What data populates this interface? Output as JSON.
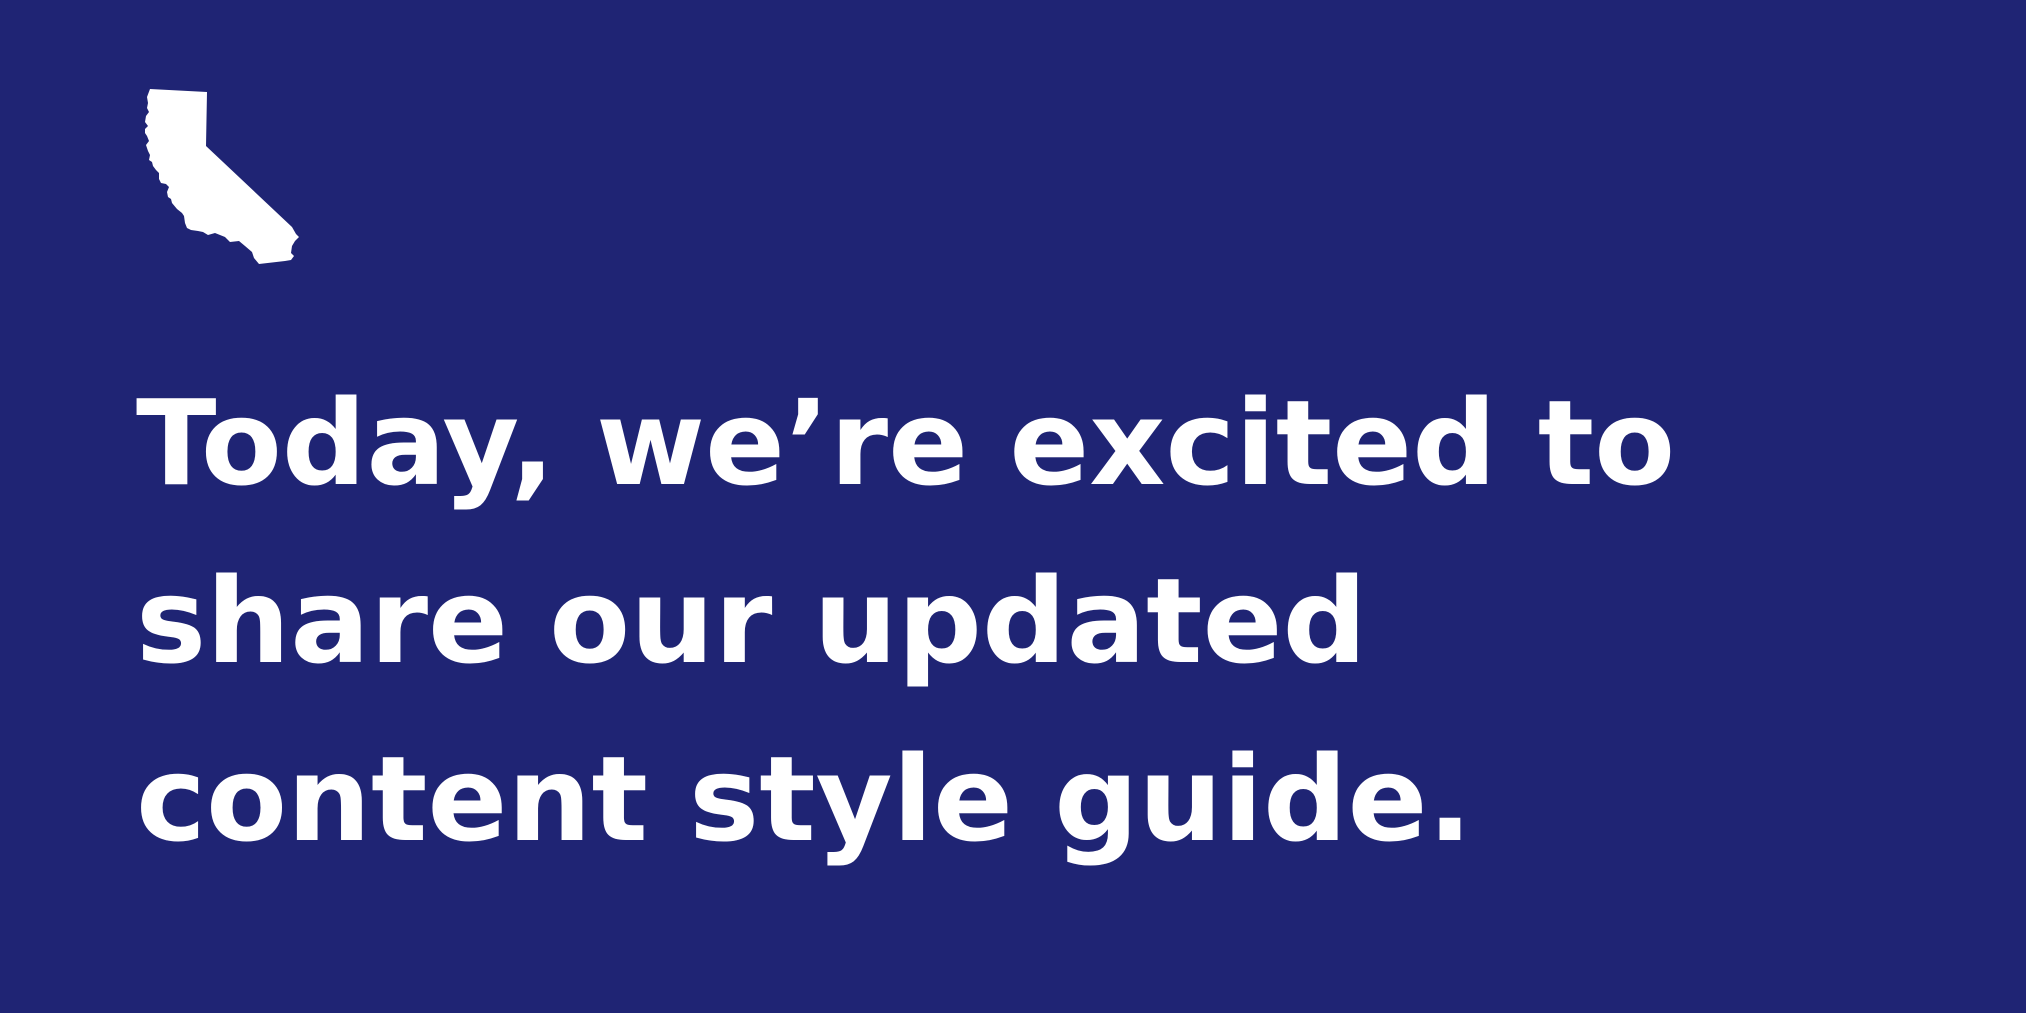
{
  "brand": {
    "background_color": "#1f2474",
    "foreground_color": "#ffffff",
    "logo_icon": "california-state-outline-icon"
  },
  "headline": {
    "lines": [
      "Today, we’re excited to",
      "share our updated",
      "content style guide."
    ]
  }
}
